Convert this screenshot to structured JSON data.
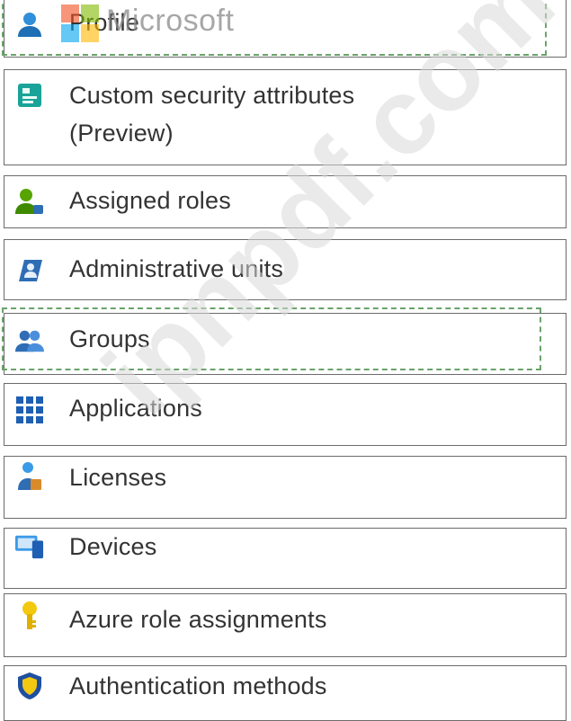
{
  "menu": {
    "items": [
      {
        "id": "profile",
        "label": "Profile",
        "icon": "profile-icon",
        "dashed": true
      },
      {
        "id": "custom-security-attributes",
        "label": "Custom security attributes",
        "label_line2": "(Preview)",
        "icon": "security-attributes-icon"
      },
      {
        "id": "assigned-roles",
        "label": "Assigned roles",
        "icon": "assigned-roles-icon"
      },
      {
        "id": "administrative-units",
        "label": "Administrative units",
        "icon": "administrative-units-icon"
      },
      {
        "id": "groups",
        "label": "Groups",
        "icon": "groups-icon",
        "dashed": true
      },
      {
        "id": "applications",
        "label": "Applications",
        "icon": "applications-icon"
      },
      {
        "id": "licenses",
        "label": "Licenses",
        "icon": "licenses-icon"
      },
      {
        "id": "devices",
        "label": "Devices",
        "icon": "devices-icon"
      },
      {
        "id": "azure-role-assignments",
        "label": "Azure role assignments",
        "icon": "azure-role-icon"
      },
      {
        "id": "authentication-methods",
        "label": "Authentication methods",
        "icon": "authentication-methods-icon"
      }
    ]
  },
  "overlay": {
    "brand_text": "Microsoft",
    "watermark_text": "ipnpdf.com"
  },
  "colors": {
    "border": "#6b6b6b",
    "dashed_highlight": "#6aa36a",
    "icon_blue": "#2f6db5",
    "icon_teal": "#1aa398",
    "icon_green": "#57a300",
    "icon_yellow": "#f2c811"
  }
}
